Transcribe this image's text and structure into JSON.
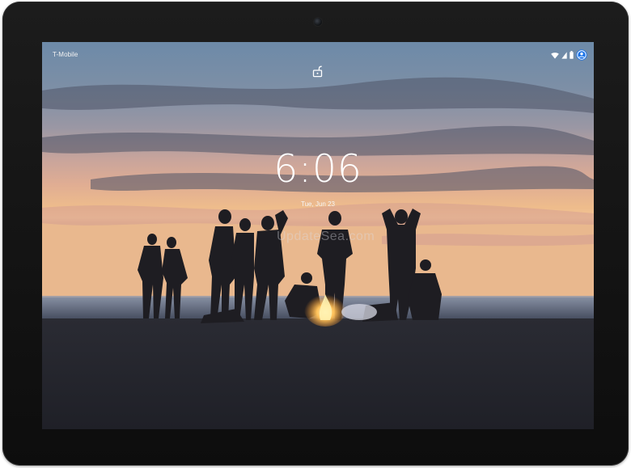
{
  "status_bar": {
    "carrier": "T-Mobile",
    "icons": [
      "wifi-icon",
      "signal-icon",
      "battery-icon",
      "account-icon"
    ],
    "accent_color": "#1a73e8"
  },
  "lock_screen": {
    "lock_state": "unlocked",
    "time": "6:06",
    "date": "Tue, Jun 23"
  },
  "wallpaper": {
    "watermark": "UpdateSea.com"
  }
}
